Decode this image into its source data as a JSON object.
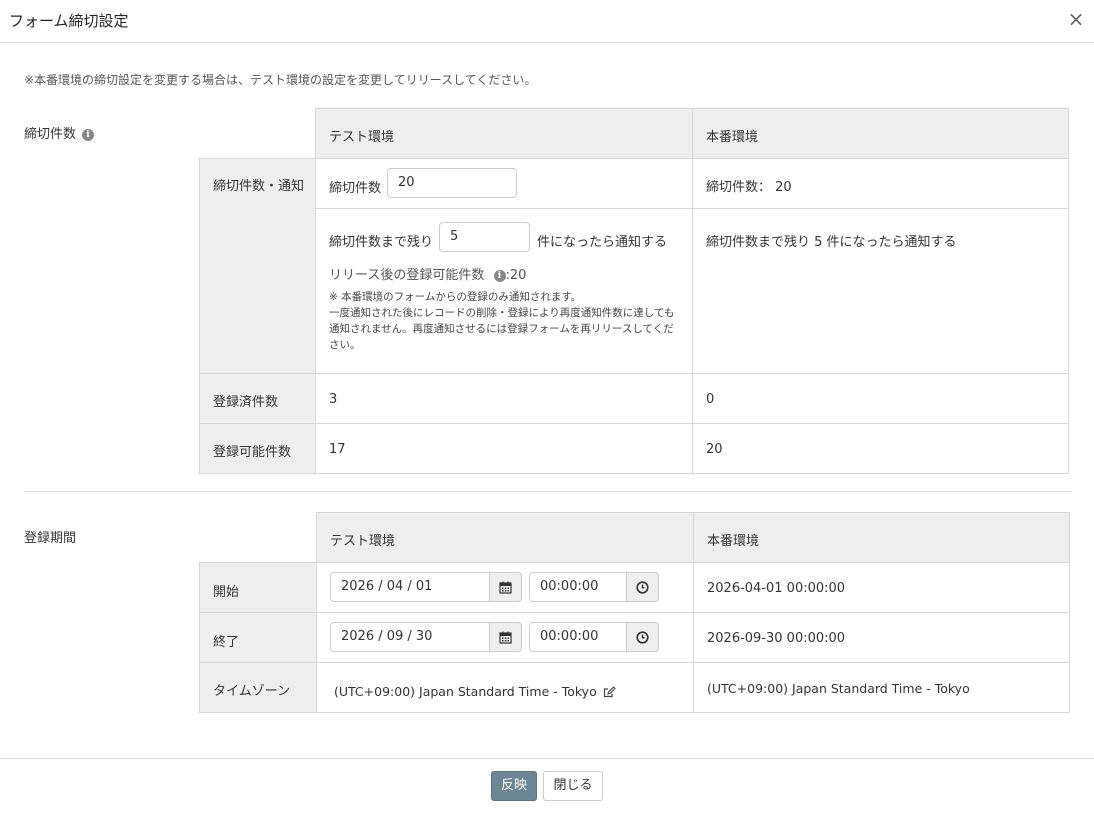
{
  "dialog": {
    "title": "フォーム締切設定",
    "close_icon": "close-icon",
    "notice": "※本番環境の締切設定を変更する場合は、テスト環境の設定を変更してリリースしてください。"
  },
  "limit_section": {
    "label": "締切件数",
    "info_icon": "info-icon",
    "col_test": "テスト環境",
    "col_prod": "本番環境",
    "row_limit_notify": "締切件数・通知",
    "limit_label": "締切件数",
    "limit_value": "20",
    "prod_limit_text": "締切件数：",
    "prod_limit_value": "20",
    "remain_prefix": "締切件数まで残り",
    "remain_value": "5",
    "remain_suffix": "件になったら通知する",
    "prod_remain_text": "締切件数まで残り 5 件になったら通知する",
    "after_release_label": "リリース後の登録可能件数",
    "after_release_value": "20",
    "note_line1": "※ 本番環境のフォームからの登録のみ通知されます。",
    "note_line2": "一度通知された後にレコードの削除・登録により再度通知件数に達しても通知されません。再度通知させるには登録フォームを再リリースしてください。",
    "row_registered": "登録済件数",
    "registered_test": "3",
    "registered_prod": "0",
    "row_available": "登録可能件数",
    "available_test": "17",
    "available_prod": "20"
  },
  "period_section": {
    "label": "登録期間",
    "col_test": "テスト環境",
    "col_prod": "本番環境",
    "row_start": "開始",
    "start_date": "2026 / 04 / 01",
    "start_time": "00:00:00",
    "start_prod": "2026-04-01 00:00:00",
    "row_end": "終了",
    "end_date": "2026 / 09 / 30",
    "end_time": "00:00:00",
    "end_prod": "2026-09-30 00:00:00",
    "row_tz": "タイムゾーン",
    "tz_test": "(UTC+09:00) Japan Standard Time - Tokyo",
    "tz_prod": "(UTC+09:00) Japan Standard Time - Tokyo",
    "calendar_icon": "calendar-icon",
    "clock_icon": "clock-icon",
    "edit_icon": "edit-icon"
  },
  "footer": {
    "apply_label": "反映",
    "close_label": "閉じる"
  }
}
